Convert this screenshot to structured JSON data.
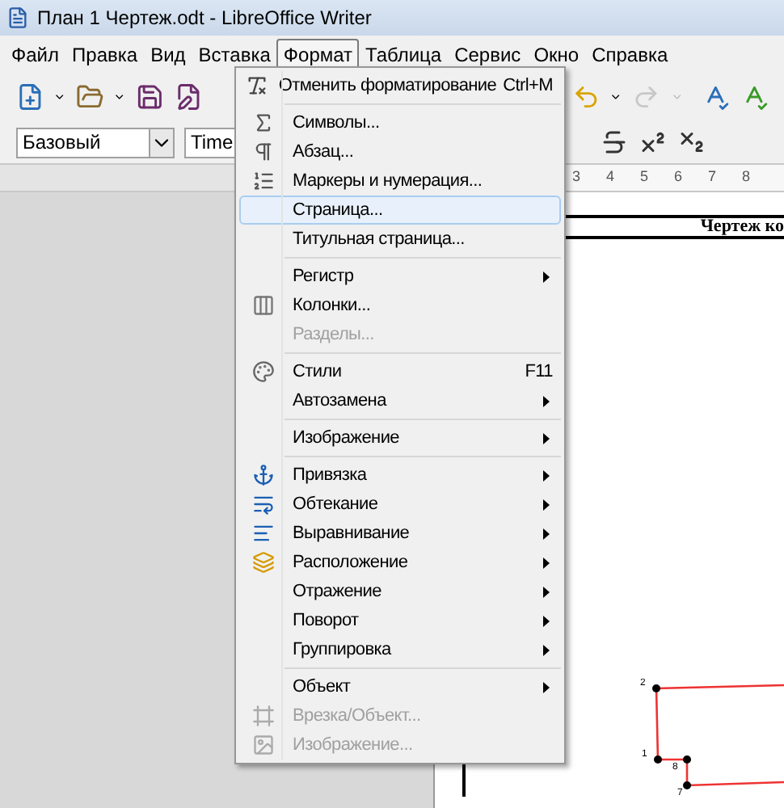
{
  "window": {
    "title": "План 1 Чертеж.odt - LibreOffice Writer"
  },
  "menubar": [
    {
      "label": "Файл",
      "selected": false
    },
    {
      "label": "Правка",
      "selected": false
    },
    {
      "label": "Вид",
      "selected": false
    },
    {
      "label": "Вставка",
      "selected": false
    },
    {
      "label": "Формат",
      "selected": true
    },
    {
      "label": "Таблица",
      "selected": false
    },
    {
      "label": "Сервис",
      "selected": false
    },
    {
      "label": "Окно",
      "selected": false
    },
    {
      "label": "Справка",
      "selected": false
    }
  ],
  "formatting": {
    "style": "Базовый",
    "font": "Time"
  },
  "ruler": [
    "3",
    "4",
    "5",
    "6",
    "7",
    "8"
  ],
  "document": {
    "table_heading": "Чертеж ко",
    "points": [
      "2",
      "1",
      "8",
      "7"
    ]
  },
  "menu": {
    "sections": [
      [
        {
          "label": "Отменить форматирование",
          "shortcut": "Ctrl+M",
          "submenu": false,
          "disabled": false,
          "selected": false
        }
      ],
      [
        {
          "label": "Символы...",
          "submenu": false,
          "disabled": false,
          "selected": false
        },
        {
          "label": "Абзац...",
          "submenu": false,
          "disabled": false,
          "selected": false
        },
        {
          "label": "Маркеры и нумерация...",
          "submenu": false,
          "disabled": false,
          "selected": false
        },
        {
          "label": "Страница...",
          "submenu": false,
          "disabled": false,
          "selected": true
        },
        {
          "label": "Титульная страница...",
          "submenu": false,
          "disabled": false,
          "selected": false
        }
      ],
      [
        {
          "label": "Регистр",
          "submenu": true,
          "disabled": false,
          "selected": false
        },
        {
          "label": "Колонки...",
          "submenu": false,
          "disabled": false,
          "selected": false
        },
        {
          "label": "Разделы...",
          "submenu": false,
          "disabled": true,
          "selected": false
        }
      ],
      [
        {
          "label": "Стили",
          "shortcut": "F11",
          "submenu": false,
          "disabled": false,
          "selected": false
        },
        {
          "label": "Автозамена",
          "submenu": true,
          "disabled": false,
          "selected": false
        }
      ],
      [
        {
          "label": "Изображение",
          "submenu": true,
          "disabled": false,
          "selected": false
        }
      ],
      [
        {
          "label": "Привязка",
          "submenu": true,
          "disabled": false,
          "selected": false
        },
        {
          "label": "Обтекание",
          "submenu": true,
          "disabled": false,
          "selected": false
        },
        {
          "label": "Выравнивание",
          "submenu": true,
          "disabled": false,
          "selected": false
        },
        {
          "label": "Расположение",
          "submenu": true,
          "disabled": false,
          "selected": false
        },
        {
          "label": "Отражение",
          "submenu": true,
          "disabled": false,
          "selected": false
        },
        {
          "label": "Поворот",
          "submenu": true,
          "disabled": false,
          "selected": false
        },
        {
          "label": "Группировка",
          "submenu": true,
          "disabled": false,
          "selected": false
        }
      ],
      [
        {
          "label": "Объект",
          "submenu": true,
          "disabled": false,
          "selected": false
        },
        {
          "label": "Врезка/Объект...",
          "submenu": false,
          "disabled": true,
          "selected": false
        },
        {
          "label": "Изображение...",
          "submenu": false,
          "disabled": true,
          "selected": false
        }
      ]
    ]
  }
}
